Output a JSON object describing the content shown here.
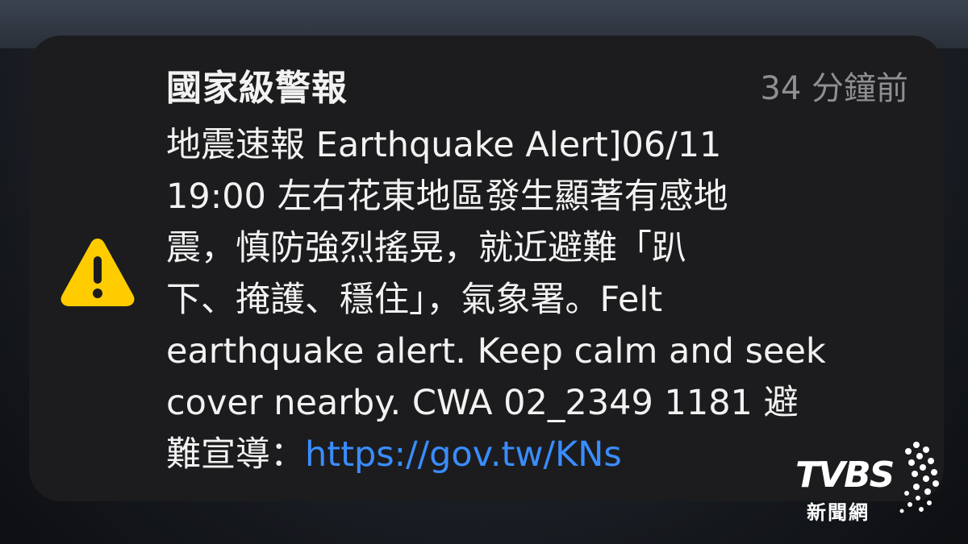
{
  "notification": {
    "title": "國家級警報",
    "time": "34 分鐘前",
    "icon": "warning-triangle-icon",
    "lines": [
      "地震速報 Earthquake Alert]06/11",
      "19:00 左右花東地區發生顯著有感地",
      "震，慎防強烈搖晃，就近避難「趴",
      "下、掩護、穩住」，氣象署。Felt",
      "earthquake alert. Keep calm and seek",
      "cover nearby. CWA 02_2349 1181 避"
    ],
    "last_line_prefix": "難宣導：",
    "link": "https://gov.tw/KNs"
  },
  "watermark": {
    "brand": "TVBS",
    "sub": "新聞網"
  },
  "colors": {
    "card_bg": "#1c1c1e",
    "text": "#f2f2f2",
    "muted": "#8e8e93",
    "link": "#3a8dff",
    "warning_yellow": "#ffcc00"
  }
}
